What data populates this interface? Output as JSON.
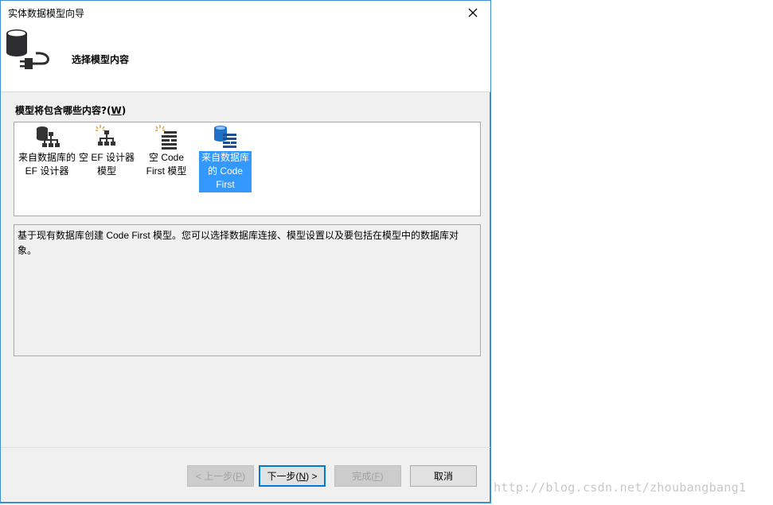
{
  "window": {
    "title": "实体数据模型向导",
    "close_glyph": "✕"
  },
  "header": {
    "title": "选择模型内容",
    "icon": "database-plug-icon"
  },
  "question": {
    "label": "模型将包含哪些内容?(",
    "accel": "W",
    "suffix": ")"
  },
  "options": [
    {
      "line1": "来自数据库的",
      "line2": "EF 设计器",
      "line3": "",
      "icon": "database-designer-icon",
      "selected": false
    },
    {
      "line1": "空 EF 设计器",
      "line2": "模型",
      "line3": "",
      "icon": "empty-designer-icon",
      "selected": false
    },
    {
      "line1": "空 Code",
      "line2": "First 模型",
      "line3": "",
      "icon": "empty-code-first-icon",
      "selected": false
    },
    {
      "line1": "来自数据库",
      "line2": "的 Code",
      "line3": "First",
      "icon": "database-code-first-icon",
      "selected": true
    }
  ],
  "description": "基于现有数据库创建 Code First 模型。您可以选择数据库连接、模型设置以及要包括在模型中的数据库对象。",
  "buttons": {
    "back": {
      "label": "< 上一步(",
      "accel": "P",
      "suffix": ")",
      "enabled": false
    },
    "next": {
      "label": "下一步(",
      "accel": "N",
      "suffix": ") >",
      "enabled": true
    },
    "finish": {
      "label": "完成(",
      "accel": "F",
      "suffix": ")",
      "enabled": false
    },
    "cancel": {
      "label": "取消",
      "enabled": true
    }
  },
  "watermark": "http://blog.csdn.net/zhoubangbang1",
  "colors": {
    "accent_border": "#3c8fd6",
    "selection": "#3399ff",
    "default_button_border": "#0078d7"
  }
}
